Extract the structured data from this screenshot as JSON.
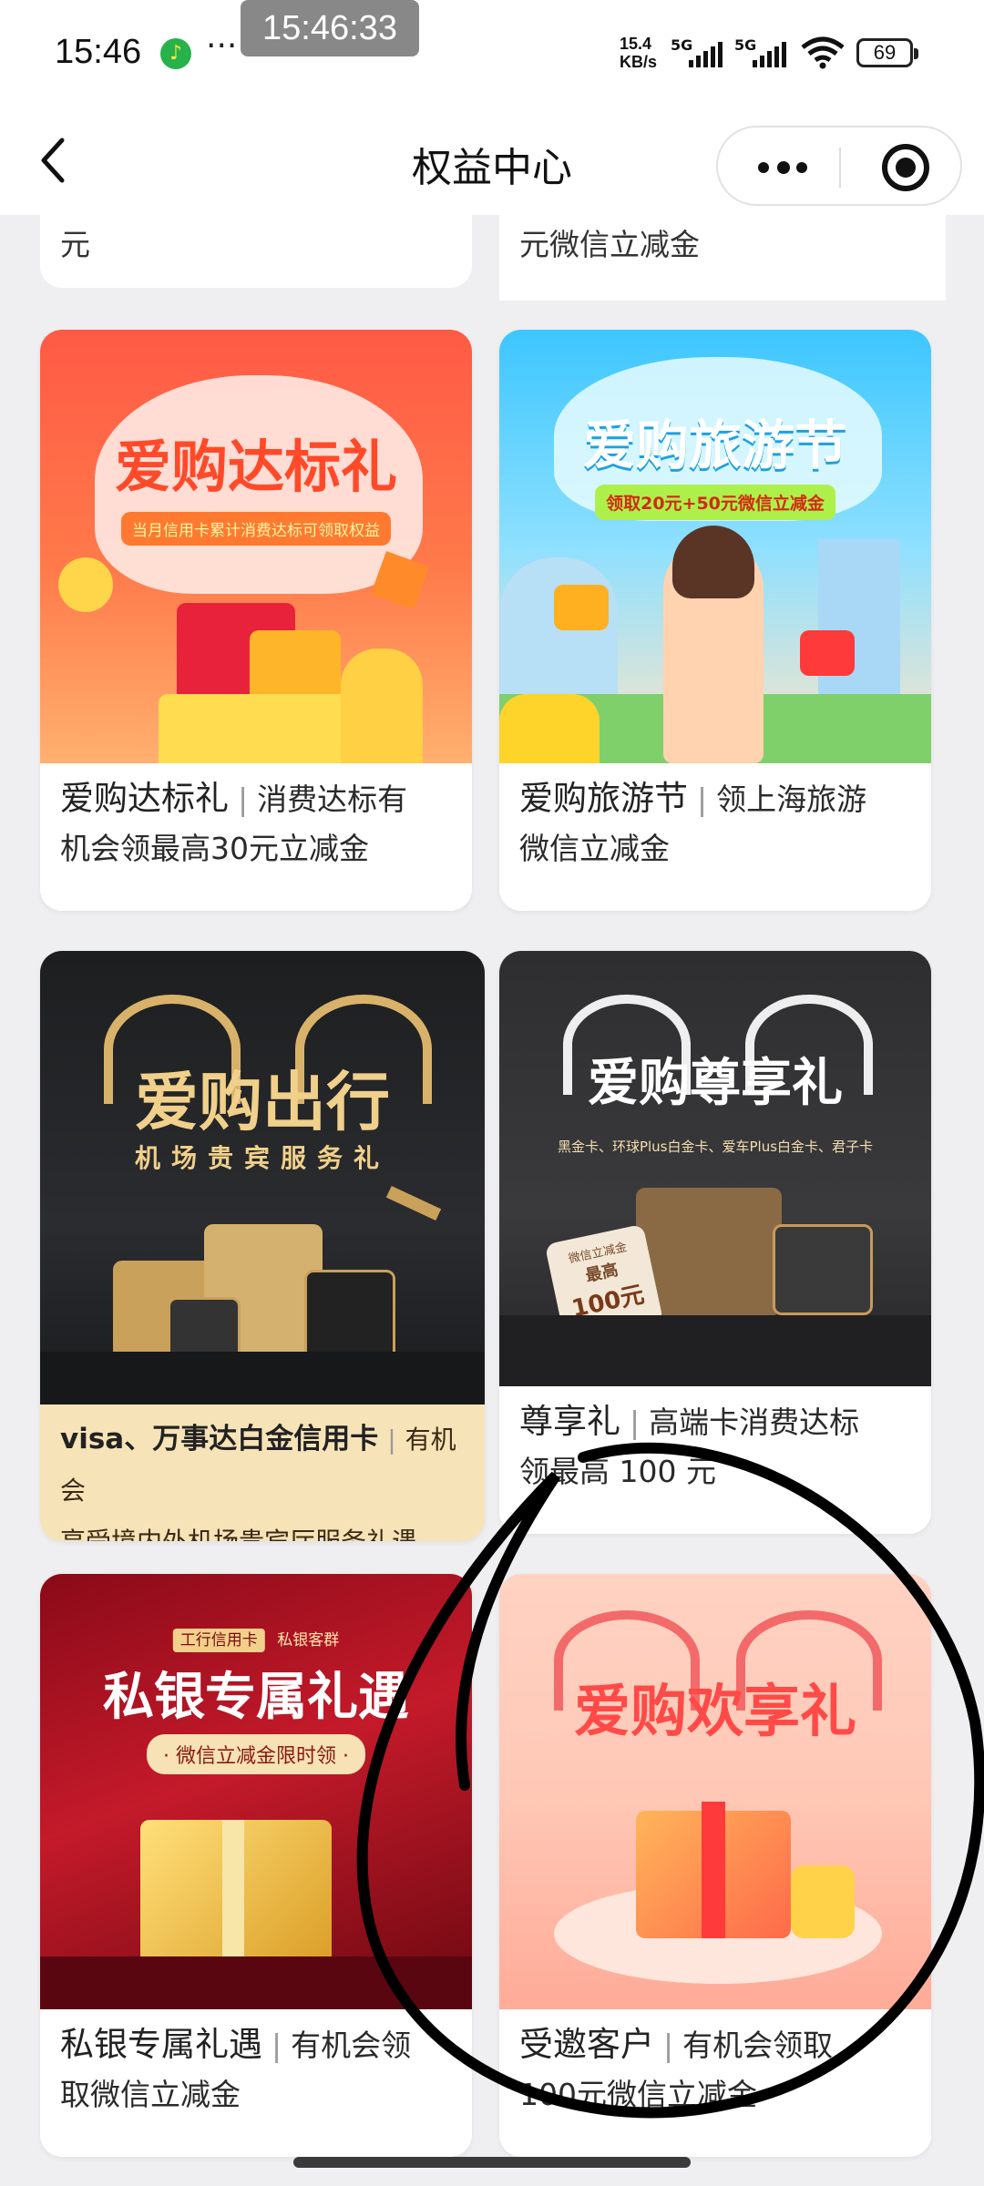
{
  "status_bar": {
    "time": "15:46",
    "overlay_time": "15:46:33",
    "more": "···",
    "net_speed_top": "15.4",
    "net_speed_unit": "KB/s",
    "sig1": "5G",
    "sig2": "5G",
    "battery": "69"
  },
  "nav": {
    "title": "权益中心"
  },
  "partial_top": {
    "left_text": "元",
    "right_text": "元微信立减金"
  },
  "cards": [
    {
      "banner_title": "爱购达标礼",
      "banner_sub": "当月信用卡累计消费达标可领取权益",
      "title": "爱购达标礼",
      "desc_line1": "消费达标有",
      "desc_line2": "机会领最高30元立减金"
    },
    {
      "banner_title": "爱购旅游节",
      "banner_sub": "领取20元+50元微信立减金",
      "title": "爱购旅游节",
      "desc_line1": "领上海旅游",
      "desc_line2": "微信立减金"
    },
    {
      "banner_title": "爱购出行",
      "banner_sub": "机场贵宾服务礼",
      "title": "visa、万事达白金信用卡",
      "desc_line1": "有机会",
      "desc_line2": "享受境内外机场贵宾厅服务礼遇"
    },
    {
      "banner_title": "爱购尊享礼",
      "banner_sub": "黑金卡、环球Plus白金卡、爱车Plus白金卡、君子卡",
      "tag_top": "微信立减金",
      "tag_mid": "最高",
      "tag_amount": "100元",
      "title": "尊享礼",
      "desc_line1": "高端卡消费达标",
      "desc_line2": "领最高 100 元"
    },
    {
      "banner_badge1": "工行信用卡",
      "banner_badge2": "私银客群",
      "banner_title": "私银专属礼遇",
      "banner_sub": "· 微信立减金限时领 ·",
      "title": "私银专属礼遇",
      "desc_line1": "有机会领",
      "desc_line2": "取微信立减金"
    },
    {
      "banner_title": "爱购欢享礼",
      "title": "受邀客户",
      "desc_line1": "有机会领取",
      "desc_line2": "100元微信立减金"
    }
  ]
}
